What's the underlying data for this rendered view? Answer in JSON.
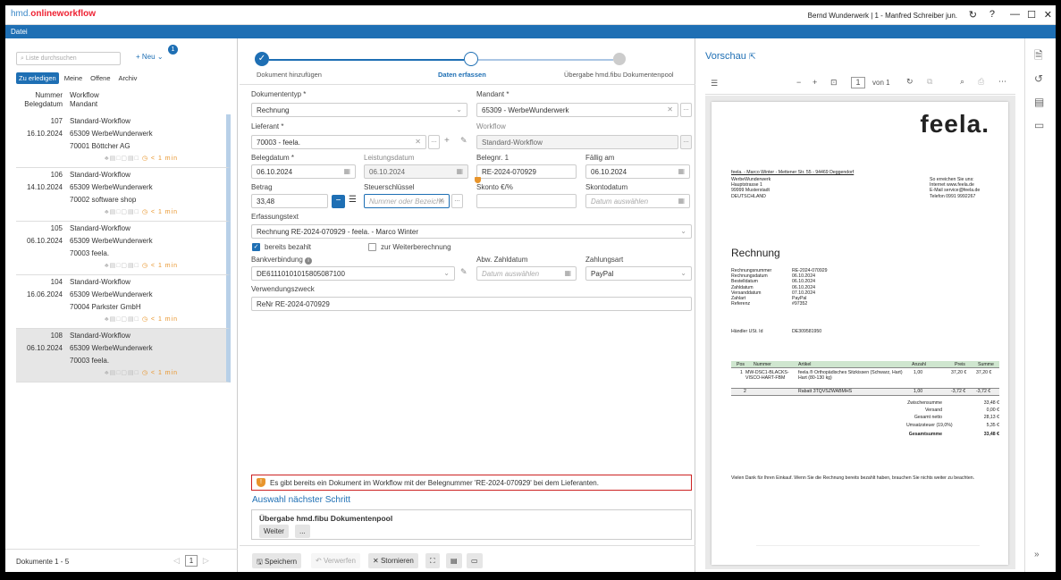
{
  "app": {
    "logo_prefix": "hmd.",
    "logo_main": "onlineworkflow",
    "user": "Bernd Wunderwerk | 1 - Manfred Schreiber jun.",
    "refresh": "↻",
    "help": "?",
    "minimize": "—",
    "maximize": "☐",
    "close": "✕"
  },
  "menu": {
    "file": "Datei"
  },
  "left": {
    "search_placeholder": "Liste durchsuchen",
    "new_label": "+ Neu",
    "new_caret": "⌄",
    "new_badge": "1",
    "tabs": [
      "Zu erledigen",
      "Meine",
      "Offene",
      "Archiv"
    ],
    "col_a1": "Nummer",
    "col_a2": "Belegdatum",
    "col_b1": "Workflow",
    "col_b2": "Mandant",
    "items": [
      {
        "num": "107",
        "date": "16.10.2024",
        "workflow": "Standard-Workflow",
        "mandant": "65309  WerbeWunderwerk",
        "vendor": "70001  Böttcher AG",
        "time": "< 1 min"
      },
      {
        "num": "106",
        "date": "14.10.2024",
        "workflow": "Standard-Workflow",
        "mandant": "65309  WerbeWunderwerk",
        "vendor": "70002  software shop",
        "time": "< 1 min"
      },
      {
        "num": "105",
        "date": "06.10.2024",
        "workflow": "Standard-Workflow",
        "mandant": "65309  WerbeWunderwerk",
        "vendor": "70003  feela.",
        "time": "< 1 min"
      },
      {
        "num": "104",
        "date": "16.06.2024",
        "workflow": "Standard-Workflow",
        "mandant": "65309  WerbeWunderwerk",
        "vendor": "70004  Parkster GmbH",
        "time": "< 1 min"
      },
      {
        "num": "108",
        "date": "06.10.2024",
        "workflow": "Standard-Workflow",
        "mandant": "65309  WerbeWunderwerk",
        "vendor": "70003  feela.",
        "time": "< 1 min"
      }
    ],
    "footer": "Dokumente 1 - 5",
    "page": "1",
    "prev": "◁",
    "next": "▷"
  },
  "steps": [
    "Dokument hinzufügen",
    "Daten erfassen",
    "Übergabe hmd.fibu Dokumentenpool"
  ],
  "form": {
    "doctype_label": "Dokumententyp *",
    "doctype": "Rechnung",
    "mandant_label": "Mandant *",
    "mandant": "65309 - WerbeWunderwerk",
    "lieferant_label": "Lieferant *",
    "lieferant": "70003 - feela.",
    "workflow_label": "Workflow",
    "workflow": "Standard-Workflow",
    "belegdatum_label": "Belegdatum *",
    "belegdatum": "06.10.2024",
    "leistungsdatum_label": "Leistungsdatum",
    "leistungsdatum": "06.10.2024",
    "belegnr_label": "Belegnr. 1",
    "belegnr": "RE-2024-070929",
    "faellig_label": "Fällig am",
    "faellig": "06.10.2024",
    "betrag_label": "Betrag",
    "betrag": "33,48",
    "steuer_label": "Steuerschlüssel",
    "steuer_placeholder": "Nummer oder Bezeichn",
    "skonto_label": "Skonto €/%",
    "skontodatum_label": "Skontodatum",
    "skontodatum_placeholder": "Datum auswählen",
    "erfassung_label": "Erfassungstext",
    "erfassung": "Rechnung RE-2024-070929 - feela. - Marco Winter",
    "bezahlt_label": "bereits bezahlt",
    "weiter_label": "zur Weiterberechnung",
    "bank_label": "Bankverbindung",
    "bank": "DE61110101015805087100",
    "abw_label": "Abw. Zahldatum",
    "abw_placeholder": "Datum auswählen",
    "zahlungsart_label": "Zahlungsart",
    "zahlungsart": "PayPal",
    "zweck_label": "Verwendungszweck",
    "zweck": "ReNr RE-2024-070929",
    "warning": "Es gibt bereits ein Dokument im Workflow mit der Belegnummer 'RE-2024-070929' bei dem Lieferanten.",
    "next_title": "Auswahl nächster Schritt",
    "next_step": "Übergabe hmd.fibu Dokumentenpool",
    "weiter_btn": "Weiter",
    "more_btn": "..."
  },
  "footer_actions": {
    "save": "Speichern",
    "discard": "Verwerfen",
    "cancel": "Stornieren"
  },
  "preview": {
    "title": "Vorschau",
    "page": "1",
    "of": "von 1",
    "brand": "feela.",
    "sender_line": "feela. - Marco Winter - Mettener Str. 55 - 94469 Deggendorf",
    "addr": [
      "WerbeWunderwerk",
      "Hauptstrasse 1",
      "99999 Musterstadt",
      "DEUTSCHLAND"
    ],
    "contact": [
      "So erreichen Sie uns:",
      "Internet  www.feela.de",
      "E-Mail   service@feela.de",
      "Telefon  0991 9992267"
    ],
    "doc_title": "Rechnung",
    "meta_keys": [
      "Rechnungsnummer",
      "Rechnungsdatum",
      "Bestelldatum",
      "Zahldatum",
      "Versanddatum",
      "Zahlart",
      "Referenz"
    ],
    "meta_vals": [
      "RE-2024-070929",
      "06.10.2024",
      "06.10.2024",
      "06.10.2024",
      "07.10.2024",
      "PayPal",
      "#97352"
    ],
    "ust_key": "Händler USt. Id",
    "ust_val": "DE309581950",
    "table_head": [
      "Pos",
      "Nummer",
      "Artikel",
      "Anzahl",
      "Preis",
      "Summe"
    ],
    "rows": [
      {
        "pos": "1",
        "nr": "MW-DSC1-BLACKS-VISCO-HART-FBM",
        "art": "feela.® Orthopädisches Sitzkissen (Schwarz, Hart) Hart (80-130 kg)",
        "anz": "1,00",
        "preis": "37,20 €",
        "summe": "37,20 €"
      },
      {
        "pos": "2",
        "nr": "",
        "art": "Rabatt 3TQVSZWABMHS",
        "anz": "1,00",
        "preis": "-3,72 €",
        "summe": "-3,72 €"
      }
    ],
    "totals_keys": [
      "Zwischensumme",
      "Versand",
      "Gesamt netto",
      "Umsatzsteuer (19,0%)",
      "Gesamtsumme"
    ],
    "totals_vals": [
      "33,48 €",
      "0,00 €",
      "28,13 €",
      "5,35 €",
      "33,48 €"
    ],
    "thanks": "Vielen Dank für Ihren Einkauf. Wenn Sie die Rechnung bereits bezahlt haben, brauchen Sie nichts weiter zu beachten."
  },
  "colors": {
    "accent": "#1e6fb4",
    "warning": "#e8952c",
    "error": "#cc2222"
  }
}
